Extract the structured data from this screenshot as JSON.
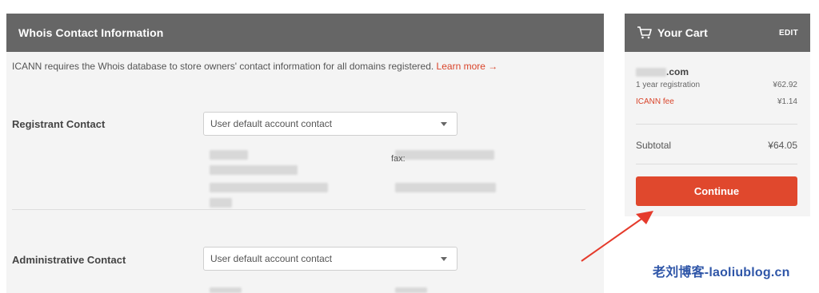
{
  "whois": {
    "header_title": "Whois Contact Information",
    "intro_text": "ICANN requires the Whois database to store owners' contact information for all domains registered. ",
    "learn_more": "Learn more →",
    "registrant_label": "Registrant Contact",
    "registrant_select": "User default account contact",
    "fax_label": "fax:",
    "administrative_label": "Administrative Contact",
    "administrative_select": "User default account contact"
  },
  "cart": {
    "title": "Your Cart",
    "edit_label": "EDIT",
    "domain_suffix": ".com",
    "items": [
      {
        "label": "1 year registration",
        "amount": "¥62.92"
      },
      {
        "label": "ICANN fee",
        "amount": "¥1.14"
      }
    ],
    "subtotal_label": "Subtotal",
    "subtotal_amount": "¥64.05",
    "continue_label": "Continue"
  },
  "watermark": "老刘博客-laoliublog.cn",
  "colors": {
    "header_bg": "#666666",
    "panel_bg": "#f4f4f4",
    "accent": "#e0482d",
    "link": "#d9442a",
    "watermark": "#2f56a8"
  },
  "icons": {
    "cart": "cart-icon",
    "caret": "chevron-down-icon"
  }
}
